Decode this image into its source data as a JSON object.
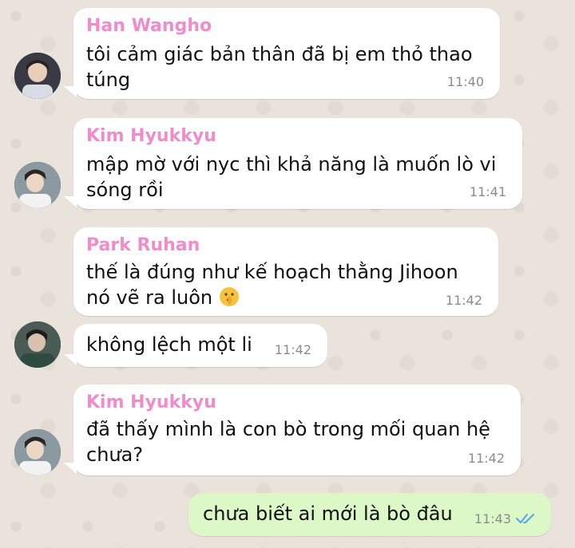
{
  "colors": {
    "sender_name": "#f08ccb",
    "bubble_incoming": "#ffffff",
    "bubble_outgoing": "#dcf8c6",
    "timestamp": "#8c8c8c",
    "read_check": "#4fa3f7"
  },
  "messages": [
    {
      "sender": "Han Wangho",
      "line1": "tôi cảm giác bản thân đã bị em thỏ thao",
      "line2": "túng",
      "time": "11:40"
    },
    {
      "sender": "Kim Hyukkyu",
      "line1": "mập mờ với nyc thì khả năng là muốn lò vi",
      "line2": "sóng rồi",
      "time": "11:41"
    },
    {
      "sender": "Park Ruhan",
      "line1": "thế là đúng như kế hoạch thằng Jihoon",
      "line2": "nó vẽ ra luôn",
      "emoji": "shushing-face-icon",
      "time": "11:42"
    },
    {
      "text": "không lệch một li",
      "time": "11:42"
    },
    {
      "sender": "Kim Hyukkyu",
      "line1": "đã thấy mình là con bò trong mối quan hệ",
      "line2": "chưa?",
      "time": "11:42"
    },
    {
      "outgoing": true,
      "text": "chưa biết ai mới là bò đâu",
      "time": "11:43",
      "status": "read"
    }
  ]
}
